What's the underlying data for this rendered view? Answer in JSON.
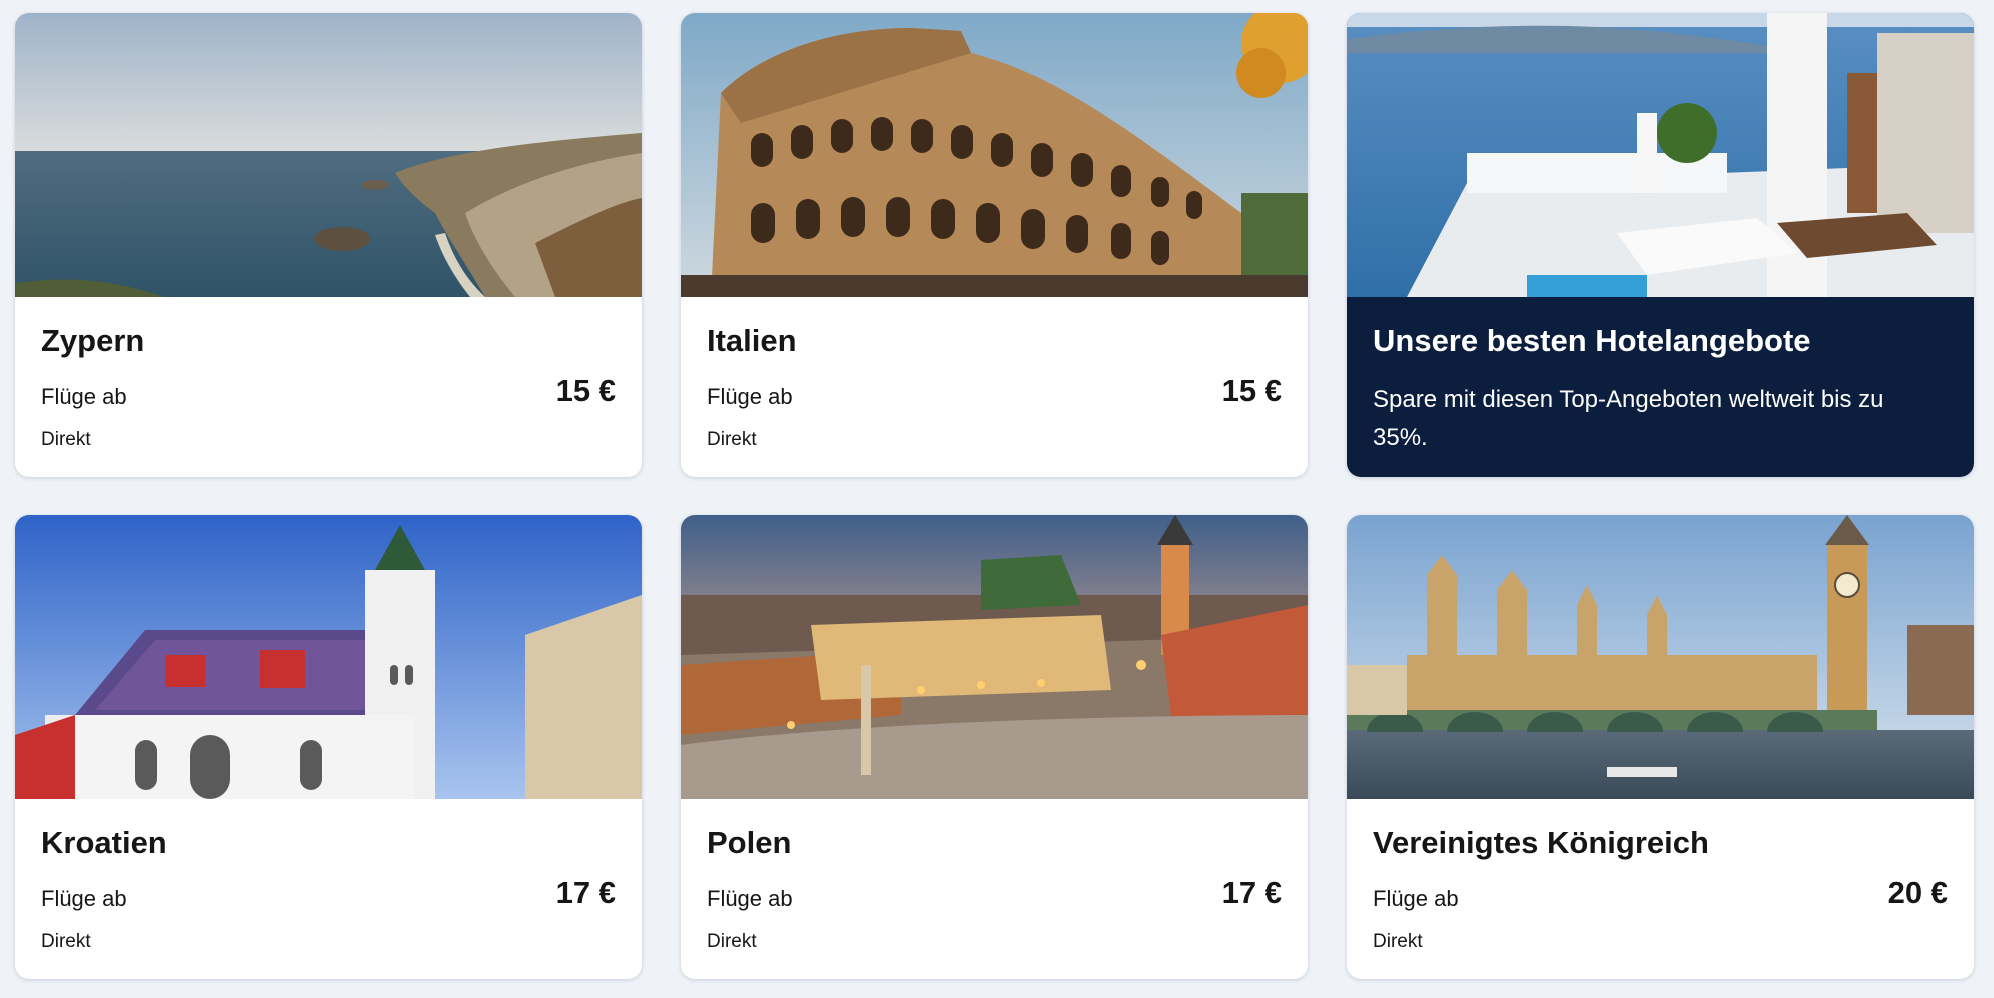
{
  "colors": {
    "page_background": "#eff3f8",
    "card_background": "#ffffff",
    "promo_background": "#0b1e3d",
    "text": "#161616"
  },
  "cards": [
    {
      "title": "Zypern",
      "from_label": "Flüge ab",
      "price": "15 €",
      "direct": "Direkt"
    },
    {
      "title": "Italien",
      "from_label": "Flüge ab",
      "price": "15 €",
      "direct": "Direkt"
    },
    {
      "title": "Unsere besten Hotelangebote",
      "text": "Spare mit diesen Top-Angeboten weltweit bis zu 35%."
    },
    {
      "title": "Kroatien",
      "from_label": "Flüge ab",
      "price": "17 €",
      "direct": "Direkt"
    },
    {
      "title": "Polen",
      "from_label": "Flüge ab",
      "price": "17 €",
      "direct": "Direkt"
    },
    {
      "title": "Vereinigtes Königreich",
      "from_label": "Flüge ab",
      "price": "20 €",
      "direct": "Direkt"
    }
  ]
}
